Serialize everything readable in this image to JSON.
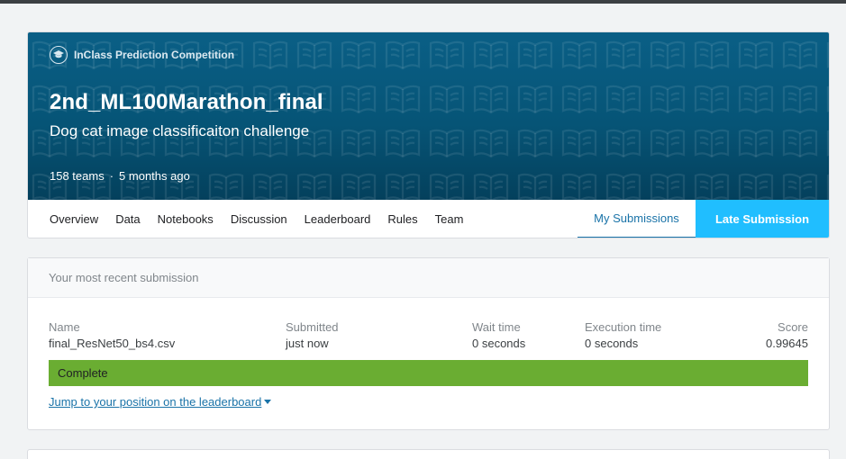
{
  "header": {
    "competition_type": "InClass Prediction Competition",
    "competition_type_icon": "graduation-cap-icon",
    "title": "2nd_ML100Marathon_final",
    "subtitle": "Dog cat image classificaiton challenge",
    "teams": "158 teams",
    "separator": "·",
    "age": "5 months ago",
    "banner_color": "#065476"
  },
  "tabs": {
    "overview": "Overview",
    "data": "Data",
    "notebooks": "Notebooks",
    "discussion": "Discussion",
    "leaderboard": "Leaderboard",
    "rules": "Rules",
    "team": "Team",
    "my_submissions": "My Submissions",
    "late_submission": "Late Submission",
    "active_color": "#1a73a8",
    "late_button_color": "#20beff"
  },
  "submission": {
    "heading": "Your most recent submission",
    "columns": {
      "name": "Name",
      "submitted": "Submitted",
      "wait": "Wait time",
      "exec": "Execution time",
      "score": "Score"
    },
    "values": {
      "name": "final_ResNet50_bs4.csv",
      "submitted": "just now",
      "wait": "0 seconds",
      "exec": "0 seconds",
      "score": "0.99645"
    },
    "status": "Complete",
    "status_color": "#6aad32",
    "jump_link": "Jump to your position on the leaderboard",
    "jump_icon": "caret-down-icon"
  }
}
